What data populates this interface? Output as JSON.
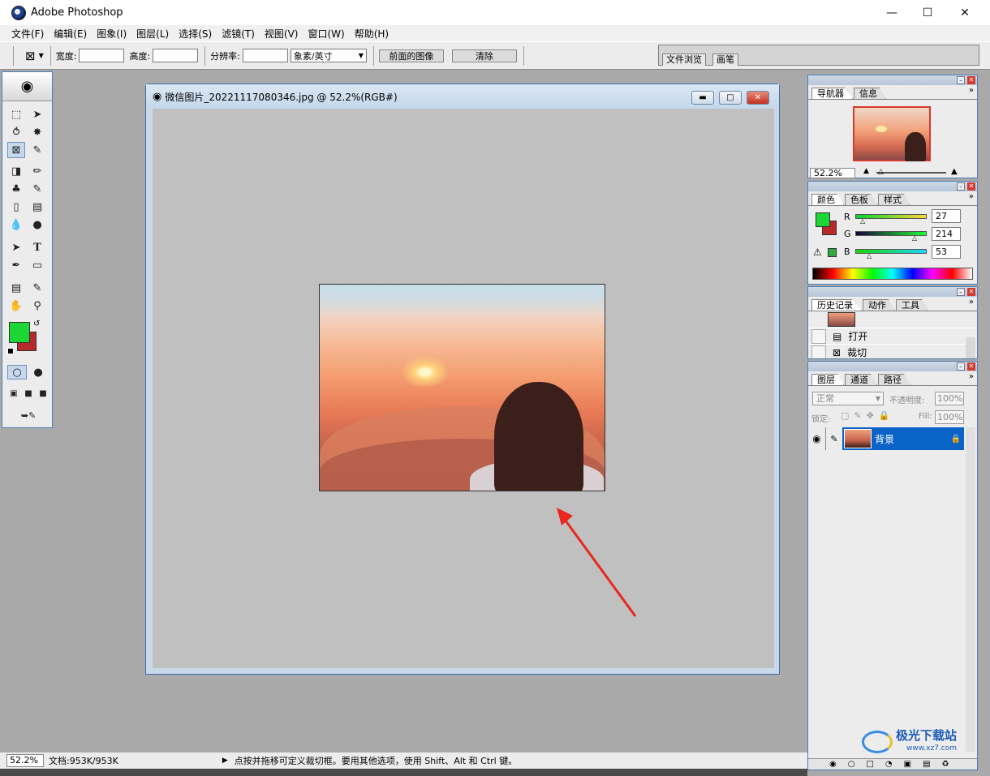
{
  "window": {
    "title": "Adobe Photoshop"
  },
  "menu": [
    "文件(F)",
    "编辑(E)",
    "图象(I)",
    "图层(L)",
    "选择(S)",
    "滤镜(T)",
    "视图(V)",
    "窗口(W)",
    "帮助(H)"
  ],
  "options": {
    "width_label": "宽度:",
    "height_label": "高度:",
    "resolution_label": "分辨率:",
    "unit_select": "象素/英寸",
    "front_image_button": "前面的图像",
    "clear_button": "清除"
  },
  "well_tabs": [
    "文件浏览",
    "画笔"
  ],
  "document": {
    "title": "微信图片_20221117080346.jpg @ 52.2%(RGB#)"
  },
  "navigator": {
    "tabs": [
      "导航器",
      "信息"
    ],
    "zoom": "52.2%"
  },
  "color": {
    "tabs": [
      "颜色",
      "色板",
      "样式"
    ],
    "r_label": "R",
    "g_label": "G",
    "b_label": "B",
    "r": "27",
    "g": "214",
    "b": "53",
    "foreground": "#1bd635",
    "background": "#b82a2a"
  },
  "history": {
    "tabs": [
      "历史记录",
      "动作",
      "工具"
    ],
    "items": [
      "打开",
      "裁切"
    ]
  },
  "layers": {
    "tabs": [
      "图层",
      "通道",
      "路径"
    ],
    "blend_mode": "正常",
    "opacity_label": "不透明度:",
    "opacity_value": "100%",
    "lock_label": "锁定:",
    "fill_label": "Fill:",
    "fill_value": "100%",
    "layer_name": "背景"
  },
  "status": {
    "zoom": "52.2%",
    "doc_size": "文档:953K/953K",
    "hint": "点按并拖移可定义裁切框。要用其他选项，使用 Shift、Alt 和 Ctrl 键。"
  },
  "watermark": {
    "site": "极光下载站",
    "url": "www.xz7.com"
  }
}
